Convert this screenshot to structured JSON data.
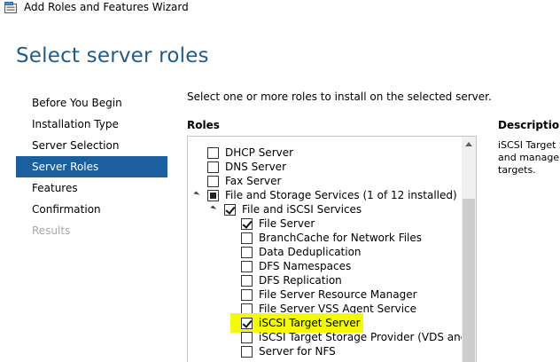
{
  "window": {
    "title": "Add Roles and Features Wizard",
    "icon": "server-wizard-icon"
  },
  "page_title": "Select server roles",
  "nav": {
    "items": [
      {
        "label": "Before You Begin",
        "state": "normal"
      },
      {
        "label": "Installation Type",
        "state": "normal"
      },
      {
        "label": "Server Selection",
        "state": "normal"
      },
      {
        "label": "Server Roles",
        "state": "active"
      },
      {
        "label": "Features",
        "state": "normal"
      },
      {
        "label": "Confirmation",
        "state": "normal"
      },
      {
        "label": "Results",
        "state": "disabled"
      }
    ]
  },
  "main": {
    "instruction": "Select one or more roles to install on the selected server.",
    "roles_heading": "Roles",
    "roles": [
      {
        "label": "DHCP Server",
        "level": 0,
        "check": "unchecked"
      },
      {
        "label": "DNS Server",
        "level": 0,
        "check": "unchecked"
      },
      {
        "label": "Fax Server",
        "level": 0,
        "check": "unchecked"
      },
      {
        "label": "File and Storage Services (1 of 12 installed)",
        "level": 0,
        "check": "partial",
        "expander": "open"
      },
      {
        "label": "File and iSCSI Services",
        "level": 1,
        "check": "checked",
        "expander": "open"
      },
      {
        "label": "File Server",
        "level": 2,
        "check": "checked"
      },
      {
        "label": "BranchCache for Network Files",
        "level": 2,
        "check": "unchecked"
      },
      {
        "label": "Data Deduplication",
        "level": 2,
        "check": "unchecked"
      },
      {
        "label": "DFS Namespaces",
        "level": 2,
        "check": "unchecked"
      },
      {
        "label": "DFS Replication",
        "level": 2,
        "check": "unchecked"
      },
      {
        "label": "File Server Resource Manager",
        "level": 2,
        "check": "unchecked"
      },
      {
        "label": "File Server VSS Agent Service",
        "level": 2,
        "check": "unchecked"
      },
      {
        "label": "iSCSI Target Server",
        "level": 2,
        "check": "checked",
        "highlight": true
      },
      {
        "label": "iSCSI Target Storage Provider (VDS and VSS",
        "level": 2,
        "check": "unchecked"
      },
      {
        "label": "Server for NFS",
        "level": 2,
        "check": "unchecked"
      }
    ]
  },
  "description": {
    "heading": "Description",
    "lines": [
      "iSCSI Target S",
      "and manager",
      "targets."
    ]
  },
  "colors": {
    "accent": "#1c5f9e",
    "title": "#1f5c8e",
    "highlight": "#f4f90b"
  }
}
